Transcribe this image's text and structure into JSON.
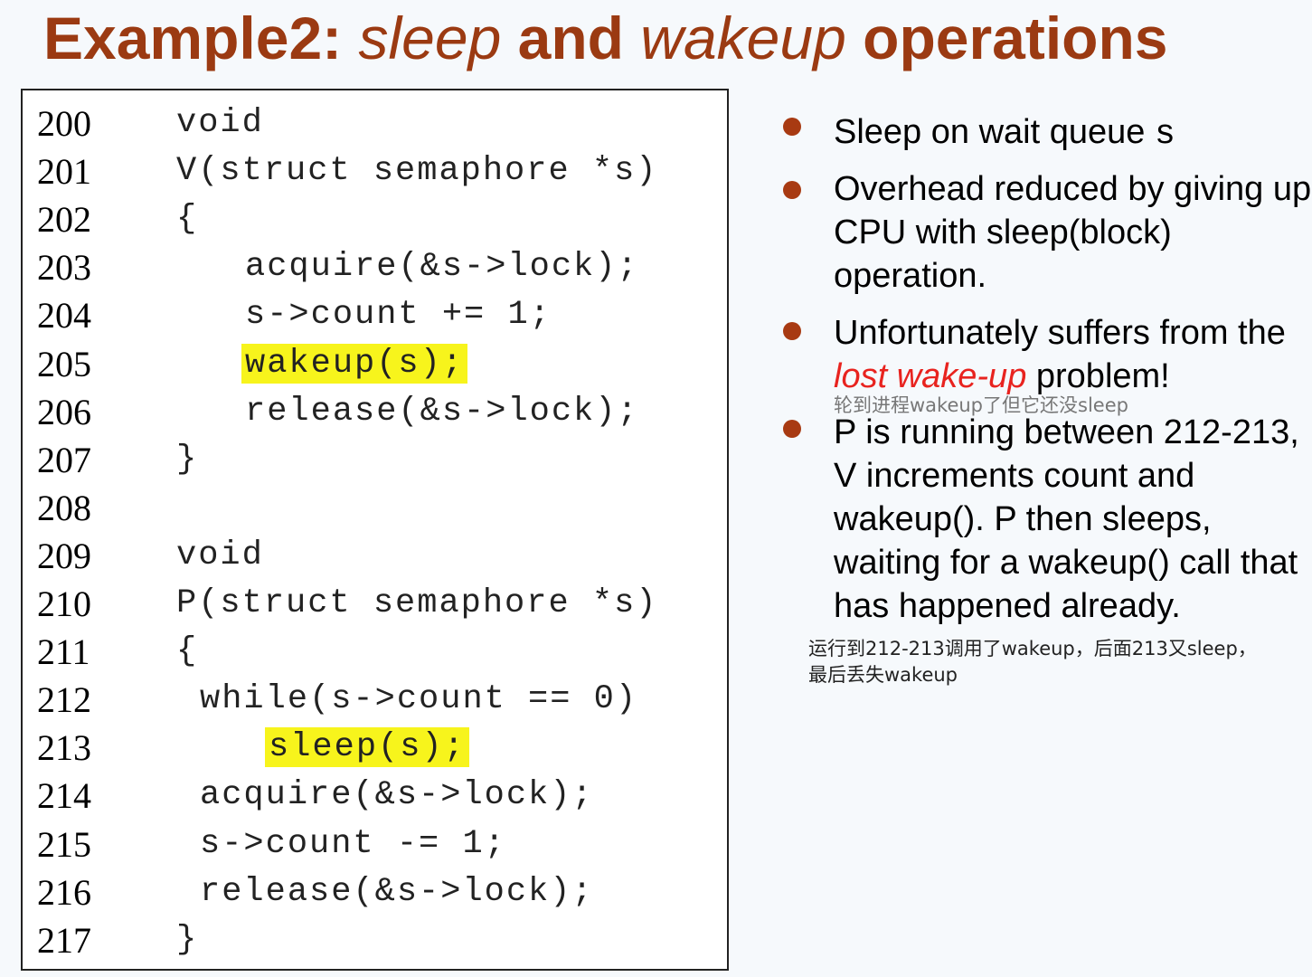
{
  "title": {
    "part1": "Example2: ",
    "part2": "sleep",
    "part3": " and ",
    "part4": "wakeup",
    "part5": " operations"
  },
  "code": [
    {
      "num": "200",
      "text": "void",
      "indent": 0,
      "highlight": false
    },
    {
      "num": "201",
      "text": "V(struct semaphore *s)",
      "indent": 0,
      "highlight": false
    },
    {
      "num": "202",
      "text": "{",
      "indent": 0,
      "highlight": false
    },
    {
      "num": "203",
      "text": "acquire(&s->lock);",
      "indent": 2,
      "highlight": false
    },
    {
      "num": "204",
      "text": "s->count += 1;",
      "indent": 2,
      "highlight": false
    },
    {
      "num": "205",
      "text": "wakeup(s);",
      "indent": 2,
      "highlight": true
    },
    {
      "num": "206",
      "text": "release(&s->lock);",
      "indent": 2,
      "highlight": false
    },
    {
      "num": "207",
      "text": "}",
      "indent": 0,
      "highlight": false
    },
    {
      "num": "208",
      "text": "",
      "indent": 0,
      "highlight": false
    },
    {
      "num": "209",
      "text": "void",
      "indent": 0,
      "highlight": false
    },
    {
      "num": "210",
      "text": "P(struct semaphore *s)",
      "indent": 0,
      "highlight": false
    },
    {
      "num": "211",
      "text": "{",
      "indent": 0,
      "highlight": false
    },
    {
      "num": "212",
      "text": "while(s->count == 0)",
      "indent": 1,
      "highlight": false
    },
    {
      "num": "213",
      "text": "sleep(s);",
      "indent": 3,
      "highlight": true
    },
    {
      "num": "214",
      "text": "acquire(&s->lock);",
      "indent": 1,
      "highlight": false
    },
    {
      "num": "215",
      "text": "s->count -= 1;",
      "indent": 1,
      "highlight": false
    },
    {
      "num": "216",
      "text": "release(&s->lock);",
      "indent": 1,
      "highlight": false
    },
    {
      "num": "217",
      "text": "}",
      "indent": 0,
      "highlight": false
    }
  ],
  "bullets": {
    "b1_text": "Sleep on wait queue ",
    "b1_code": "s",
    "b2": "Overhead reduced by giving up CPU with sleep(block) operation.",
    "b3_pre": "Unfortunately suffers from the ",
    "b3_red": "lost wake-up",
    "b3_post": " problem!",
    "b4": "P is running between 212-213, V increments count and wakeup(). P then sleeps, waiting for a wakeup() call that has happened already."
  },
  "notes": {
    "note1": "轮到进程wakeup了但它还没sleep",
    "note2_line1": "运行到212-213调用了wakeup，后面213又sleep，",
    "note2_line2": "最后丢失wakeup"
  },
  "colors": {
    "title": "#9b3a12",
    "bullet_dot": "#a83a12",
    "highlight": "#f7f41c",
    "lost_wakeup": "#e8231f"
  }
}
